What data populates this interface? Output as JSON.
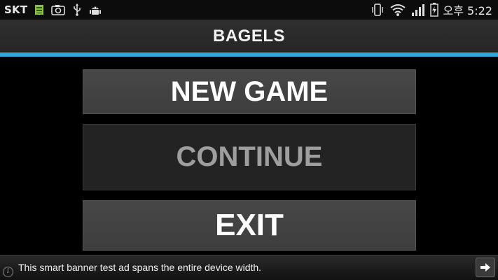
{
  "status_bar": {
    "carrier": "SKT",
    "clock": "오후 5:22",
    "left_icons": [
      "sim-card-icon",
      "camera-icon",
      "usb-icon",
      "android-debug-icon"
    ],
    "right_icons": [
      "vibrate-icon",
      "wifi-icon",
      "signal-icon",
      "battery-charging-icon"
    ]
  },
  "app_bar": {
    "title": "BAGELS",
    "accent_color": "#33a7d8"
  },
  "menu": {
    "new_game": "NEW GAME",
    "continue": "CONTINUE",
    "exit": "EXIT"
  },
  "ad_banner": {
    "text": "This smart banner test ad spans the entire device width.",
    "info_icon": "info-icon",
    "arrow_icon": "arrow-right-icon"
  }
}
